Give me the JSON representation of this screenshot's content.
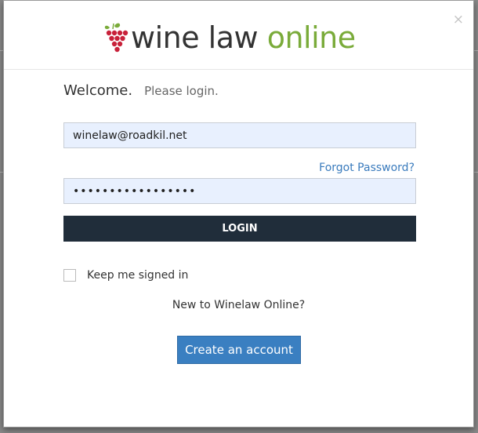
{
  "logo": {
    "word_dark": "wine law",
    "word_green": "online",
    "icon": "grape-cluster-icon",
    "colors": {
      "dark": "#333333",
      "green": "#7aab3a",
      "grape": "#c8213a",
      "leaf": "#7aab3a"
    }
  },
  "dialog": {
    "close_glyph": "×",
    "welcome": "Welcome.",
    "please_login": "Please login."
  },
  "form": {
    "email_value": "winelaw@roadkil.net",
    "password_value": "•••••••••••••••••",
    "forgot_label": "Forgot Password?",
    "login_label": "LOGIN",
    "keep_signed_in_label": "Keep me signed in",
    "keep_signed_in_checked": false
  },
  "signup": {
    "prompt": "New to Winelaw Online?",
    "create_label": "Create an account"
  },
  "colors": {
    "login_button": "#202d3a",
    "create_button": "#3a7fc1",
    "link": "#3a7bbd",
    "input_fill": "#e8f0fe"
  }
}
